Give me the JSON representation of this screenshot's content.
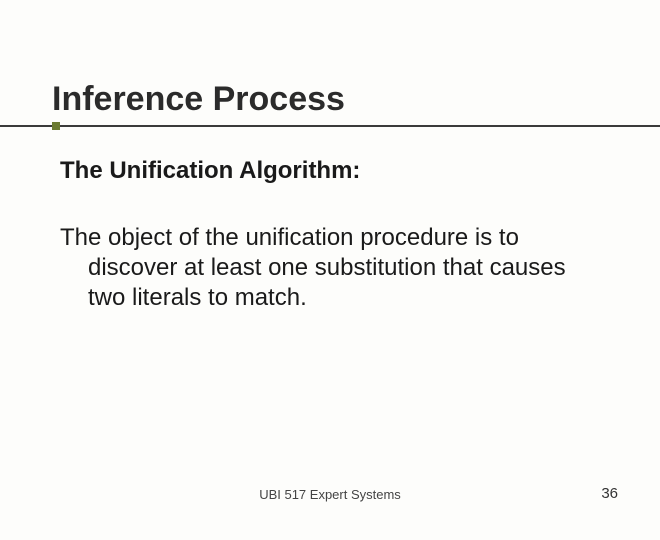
{
  "slide": {
    "title": "Inference Process",
    "subheading": "The Unification Algorithm:",
    "body": "The object of the unification procedure is to discover at least one substitution that causes two literals to match.",
    "footer": "UBI 517 Expert Systems",
    "page_number": "36"
  }
}
